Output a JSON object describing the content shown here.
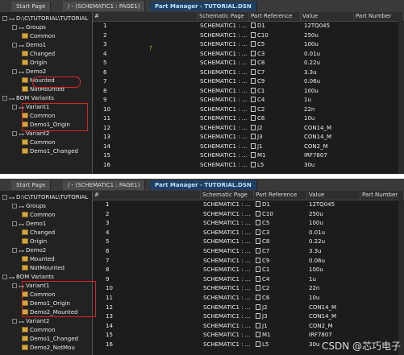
{
  "tabs": [
    {
      "label": "Start Page"
    },
    {
      "label": "/ - (SCHEMATIC1 : PAGE1)"
    },
    {
      "label": "Part Manager - TUTORIAL.DSN"
    }
  ],
  "columns": [
    "#",
    "Schematic Page",
    "Part Reference",
    "Value",
    "Part Number"
  ],
  "top_tree": [
    {
      "label": "D:\\C\\TUTORIAL\\TUTORIAL",
      "indent": 0,
      "type": "node"
    },
    {
      "label": "Groups",
      "indent": 1,
      "type": "node"
    },
    {
      "label": "Common",
      "indent": 2,
      "type": "folder"
    },
    {
      "label": "Demo1",
      "indent": 1,
      "type": "node"
    },
    {
      "label": "Changed",
      "indent": 2,
      "type": "folder"
    },
    {
      "label": "Origin",
      "indent": 2,
      "type": "folder"
    },
    {
      "label": "Demo2",
      "indent": 1,
      "type": "node"
    },
    {
      "label": "Mounted",
      "indent": 2,
      "type": "folder"
    },
    {
      "label": "NotMounted",
      "indent": 2,
      "type": "folder"
    },
    {
      "label": "BOM Variants",
      "indent": 0,
      "type": "node"
    },
    {
      "label": "Variant1",
      "indent": 1,
      "type": "node"
    },
    {
      "label": "Common",
      "indent": 2,
      "type": "folder"
    },
    {
      "label": "Demo1_Origin",
      "indent": 2,
      "type": "folder"
    },
    {
      "label": "Variant2",
      "indent": 1,
      "type": "node"
    },
    {
      "label": "Common",
      "indent": 2,
      "type": "folder"
    },
    {
      "label": "Demo1_Changed",
      "indent": 2,
      "type": "folder"
    }
  ],
  "bottom_tree": [
    {
      "label": "D:\\C\\TUTORIAL\\TUTORIAL",
      "indent": 0,
      "type": "node"
    },
    {
      "label": "Groups",
      "indent": 1,
      "type": "node"
    },
    {
      "label": "Common",
      "indent": 2,
      "type": "folder"
    },
    {
      "label": "Demo1",
      "indent": 1,
      "type": "node"
    },
    {
      "label": "Changed",
      "indent": 2,
      "type": "folder"
    },
    {
      "label": "Origin",
      "indent": 2,
      "type": "folder"
    },
    {
      "label": "Demo2",
      "indent": 1,
      "type": "node"
    },
    {
      "label": "Mounted",
      "indent": 2,
      "type": "folder"
    },
    {
      "label": "NotMounted",
      "indent": 2,
      "type": "folder"
    },
    {
      "label": "BOM Variants",
      "indent": 0,
      "type": "node"
    },
    {
      "label": "Variant1",
      "indent": 1,
      "type": "node"
    },
    {
      "label": "Common",
      "indent": 2,
      "type": "folder"
    },
    {
      "label": "Demo1_Origin",
      "indent": 2,
      "type": "folder"
    },
    {
      "label": "Demo2_Mounted",
      "indent": 2,
      "type": "folder"
    },
    {
      "label": "Variant2",
      "indent": 1,
      "type": "node"
    },
    {
      "label": "Common",
      "indent": 2,
      "type": "folder"
    },
    {
      "label": "Demo1_Changed",
      "indent": 2,
      "type": "folder"
    },
    {
      "label": "Demo2_NotMou",
      "indent": 2,
      "type": "folder"
    }
  ],
  "rows": [
    {
      "n": "1",
      "page": "SCHEMATIC1 : ...",
      "ref": "D1",
      "value": "12TQ045"
    },
    {
      "n": "2",
      "page": "SCHEMATIC1 : ...",
      "ref": "C10",
      "value": "250u"
    },
    {
      "n": "3",
      "page": "SCHEMATIC1 : ...",
      "ref": "C5",
      "value": "100u"
    },
    {
      "n": "4",
      "page": "SCHEMATIC1 : ...",
      "ref": "C3",
      "value": "0.01u"
    },
    {
      "n": "5",
      "page": "SCHEMATIC1 : ...",
      "ref": "C8",
      "value": "0.22u"
    },
    {
      "n": "6",
      "page": "SCHEMATIC1 : ...",
      "ref": "C7",
      "value": "3.3u"
    },
    {
      "n": "7",
      "page": "SCHEMATIC1 : ...",
      "ref": "C9",
      "value": "0.06u"
    },
    {
      "n": "8",
      "page": "SCHEMATIC1 : ...",
      "ref": "C1",
      "value": "100u"
    },
    {
      "n": "9",
      "page": "SCHEMATIC1 : ...",
      "ref": "C4",
      "value": "1u"
    },
    {
      "n": "10",
      "page": "SCHEMATIC1 : ...",
      "ref": "C2",
      "value": "22n"
    },
    {
      "n": "11",
      "page": "SCHEMATIC1 : ...",
      "ref": "C6",
      "value": "10u"
    },
    {
      "n": "12",
      "page": "SCHEMATIC1 : ...",
      "ref": "J2",
      "value": "CON14_M"
    },
    {
      "n": "13",
      "page": "SCHEMATIC1 : ...",
      "ref": "J3",
      "value": "CON14_M"
    },
    {
      "n": "14",
      "page": "SCHEMATIC1 : ...",
      "ref": "J1",
      "value": "CON2_M"
    },
    {
      "n": "15",
      "page": "SCHEMATIC1 : ...",
      "ref": "M1",
      "value": "IRF7807"
    },
    {
      "n": "16",
      "page": "SCHEMATIC1 : ...",
      "ref": "L5",
      "value": "30u"
    }
  ],
  "top_marker": "?",
  "watermark": "CSDN @芯巧电子"
}
